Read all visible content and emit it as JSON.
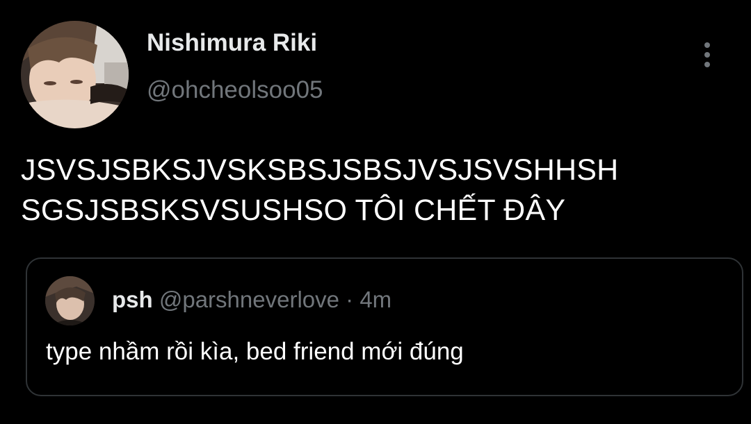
{
  "tweet": {
    "author": {
      "display_name": "Nishimura Riki",
      "handle": "@ohcheolsoo05"
    },
    "text_lines": [
      "JSVSJSBKSJVSKSBSJSBSJVSJSVSHHSH",
      "SGSJSBSKSVSUSHSO TÔI CHẾT ĐÂY"
    ],
    "more_icon": "more-vertical-icon"
  },
  "quoted_tweet": {
    "display_name": "psh",
    "handle": "@parshneverlove",
    "separator": "·",
    "time": "4m",
    "text": "type nhầm rồi kìa, bed friend mới đúng"
  },
  "colors": {
    "background": "#000000",
    "primary_text": "#e7e9ea",
    "secondary_text": "#71767b",
    "border": "#2f3336"
  }
}
